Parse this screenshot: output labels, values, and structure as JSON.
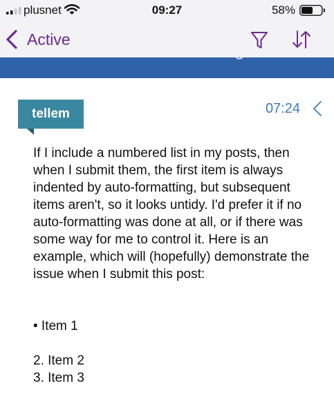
{
  "status_bar": {
    "carrier": "plusnet",
    "time": "09:27",
    "battery_percent": "58%",
    "battery_level": 0.58,
    "signal_bars": 2
  },
  "nav": {
    "back_label": "Active",
    "filter_icon": "filter-icon",
    "sort_icon": "sort-icon"
  },
  "post": {
    "author": "tellem",
    "time": "07:24",
    "body": {
      "intro": "If I include a numbered list in my posts, then when I submit them, the first item is always indented by auto-formatting, but subsequent items aren't, so it looks untidy. I'd prefer it if no auto-formatting was done at all, or if there was some way for me to control it. Here is an example, which will (hopefully) demonstrate the issue when I submit this post:",
      "bullet_item": "• Item 1",
      "item_2": "2. Item 2",
      "item_3": "3. Item 3"
    }
  },
  "colors": {
    "nav_background": "#f3f2f4",
    "accent_purple": "#6b2a8c",
    "banner_blue": "#2f62a8",
    "author_tag": "#3a87a0",
    "time_blue": "#3a7dbe"
  }
}
